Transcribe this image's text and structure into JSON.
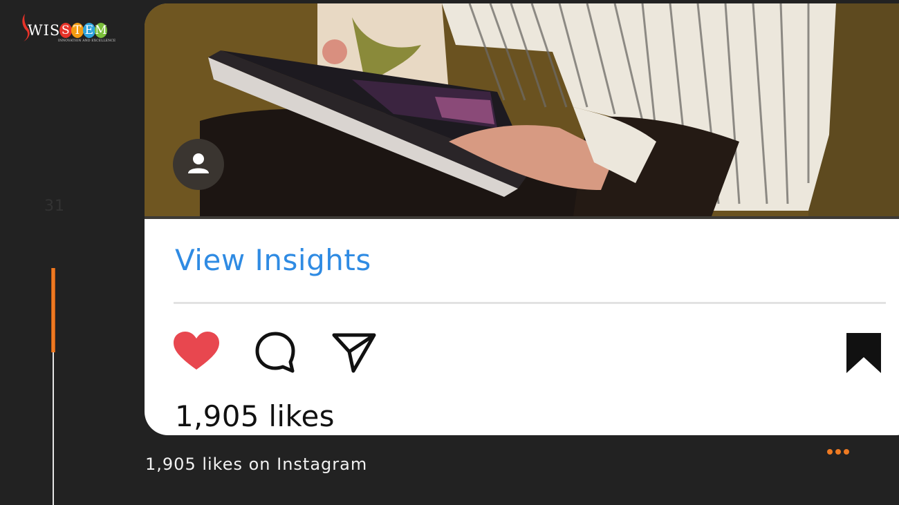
{
  "brand": {
    "name_prefix": "WIS",
    "name_letters": [
      "S",
      "T",
      "E",
      "M"
    ],
    "letter_colors": [
      "#e63329",
      "#f39c12",
      "#2ea3dc",
      "#7bbf3a"
    ],
    "tagline": "INNOVATION AND EXCELLENCE",
    "accent": "#e63329"
  },
  "slide": {
    "number": "31",
    "progress_fraction": 0.36,
    "accent": "#ee7a22"
  },
  "post": {
    "view_insights": "View Insights",
    "likes_text": "1,905 likes",
    "link_color": "#2f8be3",
    "like_color": "#e8474f",
    "actions": [
      "heart-icon",
      "comment-icon",
      "share-icon",
      "bookmark-icon"
    ],
    "avatar_icon": "person-icon"
  },
  "caption": "1,905 likes on Instagram",
  "menu_icon": "more-dots-icon"
}
